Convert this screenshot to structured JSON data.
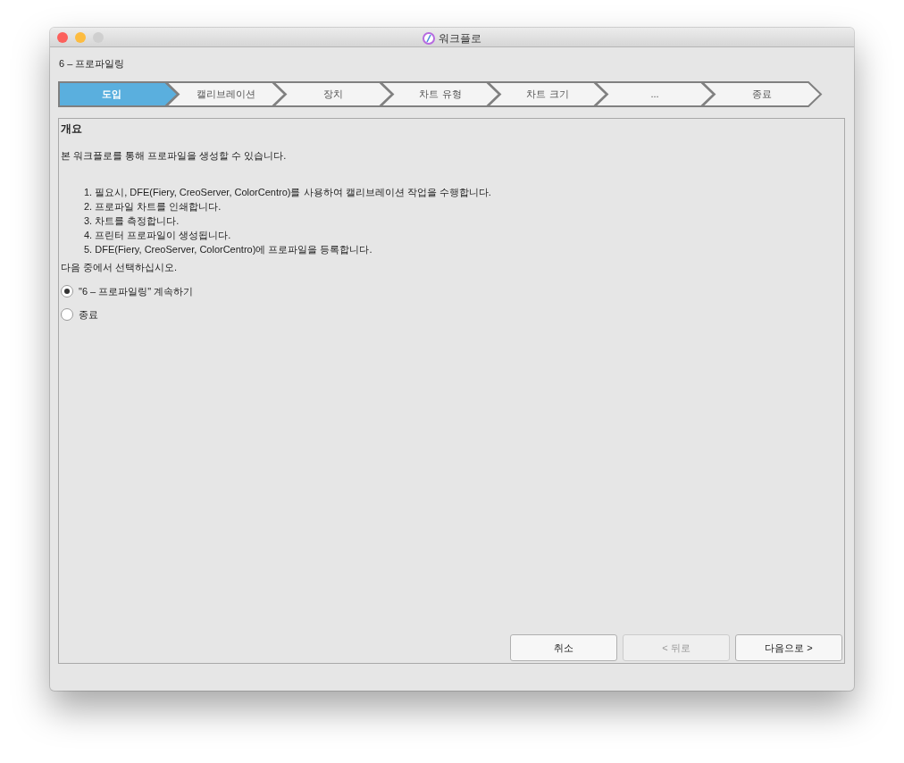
{
  "window": {
    "title": "워크플로"
  },
  "heading": "6 – 프로파일링",
  "steps": [
    {
      "label": "도입",
      "selected": true
    },
    {
      "label": "캘리브레이션",
      "selected": false
    },
    {
      "label": "장치",
      "selected": false
    },
    {
      "label": "차트 유형",
      "selected": false
    },
    {
      "label": "차트 크기",
      "selected": false
    },
    {
      "label": "...",
      "selected": false
    },
    {
      "label": "종료",
      "selected": false
    }
  ],
  "panel": {
    "title": "개요",
    "intro": "본 워크플로를 통해 프로파일을 생성할 수 있습니다.",
    "steps_list": [
      "1. 필요시, DFE(Fiery, CreoServer, ColorCentro)를 사용하여 캘리브레이션 작업을 수행합니다.",
      "2. 프로파일 차트를 인쇄합니다.",
      "3. 차트를 측정합니다.",
      "4. 프린터 프로파일이 생성됩니다.",
      "5. DFE(Fiery, CreoServer, ColorCentro)에 프로파일을 등록합니다."
    ],
    "prompt": "다음 중에서 선택하십시오.",
    "options": [
      {
        "label": "\"6 – 프로파일링\" 계속하기",
        "selected": true
      },
      {
        "label": "종료",
        "selected": false
      }
    ]
  },
  "buttons": [
    {
      "label": "취소",
      "disabled": false
    },
    {
      "label": "< 뒤로",
      "disabled": true
    },
    {
      "label": "다음으로 >",
      "disabled": false
    }
  ]
}
